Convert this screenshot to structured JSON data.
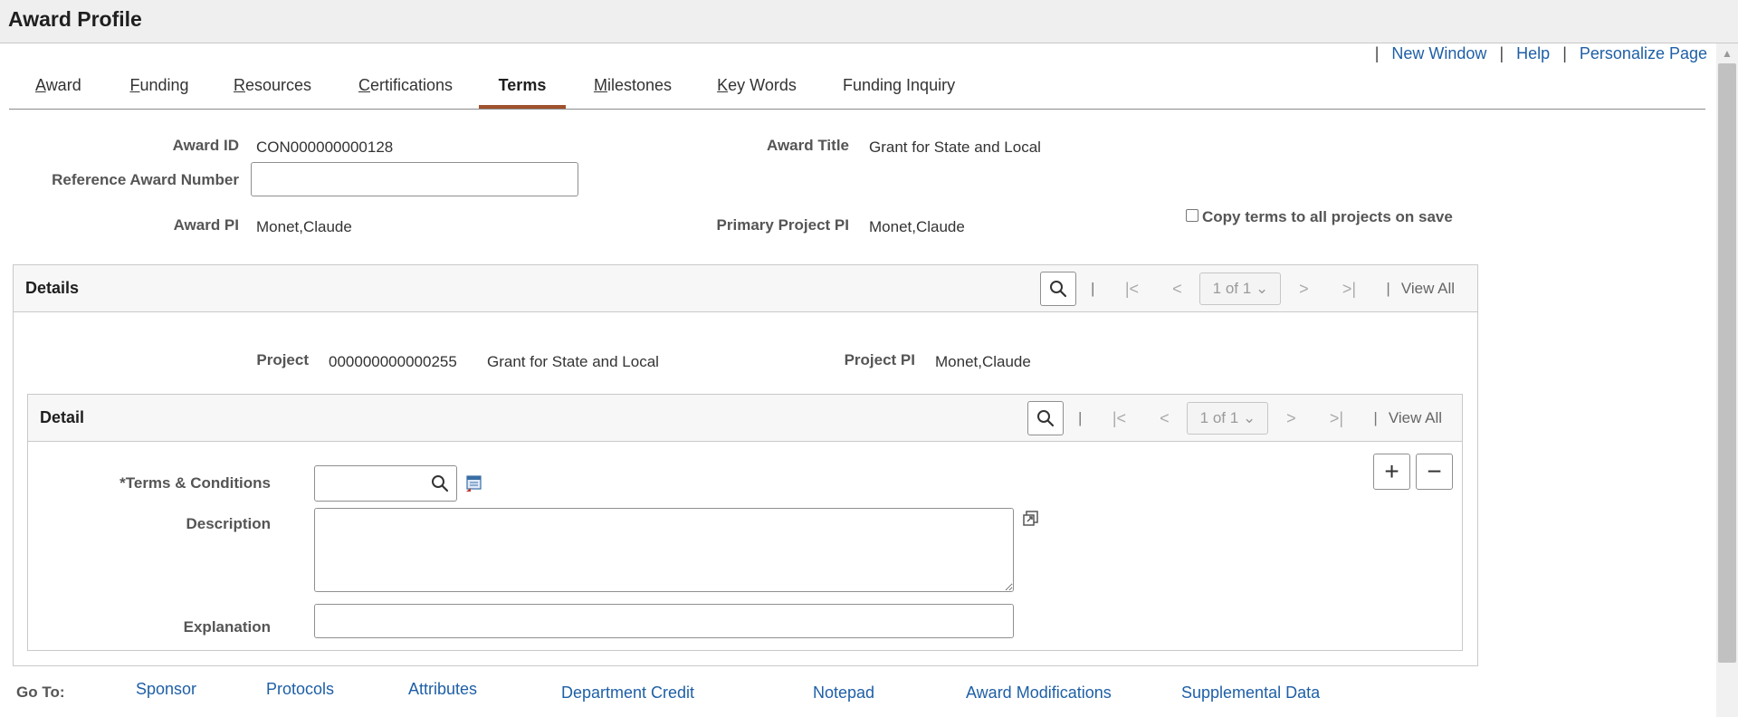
{
  "header": {
    "title": "Award Profile"
  },
  "toplinks": [
    {
      "label": "New Window"
    },
    {
      "label": "Help"
    },
    {
      "label": "Personalize Page"
    }
  ],
  "tabs": [
    {
      "accesskey": "A",
      "rest": "ward"
    },
    {
      "accesskey": "F",
      "rest": "unding"
    },
    {
      "accesskey": "R",
      "rest": "esources"
    },
    {
      "accesskey": "C",
      "rest": "ertifications"
    },
    {
      "accesskey": "",
      "rest": "Terms"
    },
    {
      "accesskey": "M",
      "rest": "ilestones"
    },
    {
      "accesskey": "K",
      "rest": "ey Words"
    },
    {
      "accesskey": "",
      "rest": "Funding Inquiry"
    }
  ],
  "award": {
    "award_id_label": "Award ID",
    "award_id": "CON000000000128",
    "award_title_label": "Award Title",
    "award_title": "Grant for State and Local",
    "ref_label": "Reference Award Number",
    "ref_value": "",
    "pi_label": "Award PI",
    "pi": "Monet,Claude",
    "primary_pi_label": "Primary Project PI",
    "primary_pi": "Monet,Claude",
    "copy_terms_label": "Copy terms to all projects on save",
    "copy_terms_checked": false
  },
  "details": {
    "title": "Details",
    "pager": "1 of 1",
    "view_all": "View All",
    "project_label": "Project",
    "project_id": "000000000000255",
    "project_desc": "Grant for State and Local",
    "project_pi_label": "Project PI",
    "project_pi": "Monet,Claude"
  },
  "detail": {
    "title": "Detail",
    "pager": "1 of 1",
    "view_all": "View All",
    "terms_label": "*Terms & Conditions",
    "terms_value": "",
    "description_label": "Description",
    "description_value": "",
    "explanation_label": "Explanation",
    "explanation_value": ""
  },
  "goto": {
    "label": "Go To:",
    "links": [
      "Sponsor",
      "Protocols",
      "Attributes",
      "Department Credit",
      "Notepad",
      "Award Modifications",
      "Supplemental Data"
    ]
  }
}
